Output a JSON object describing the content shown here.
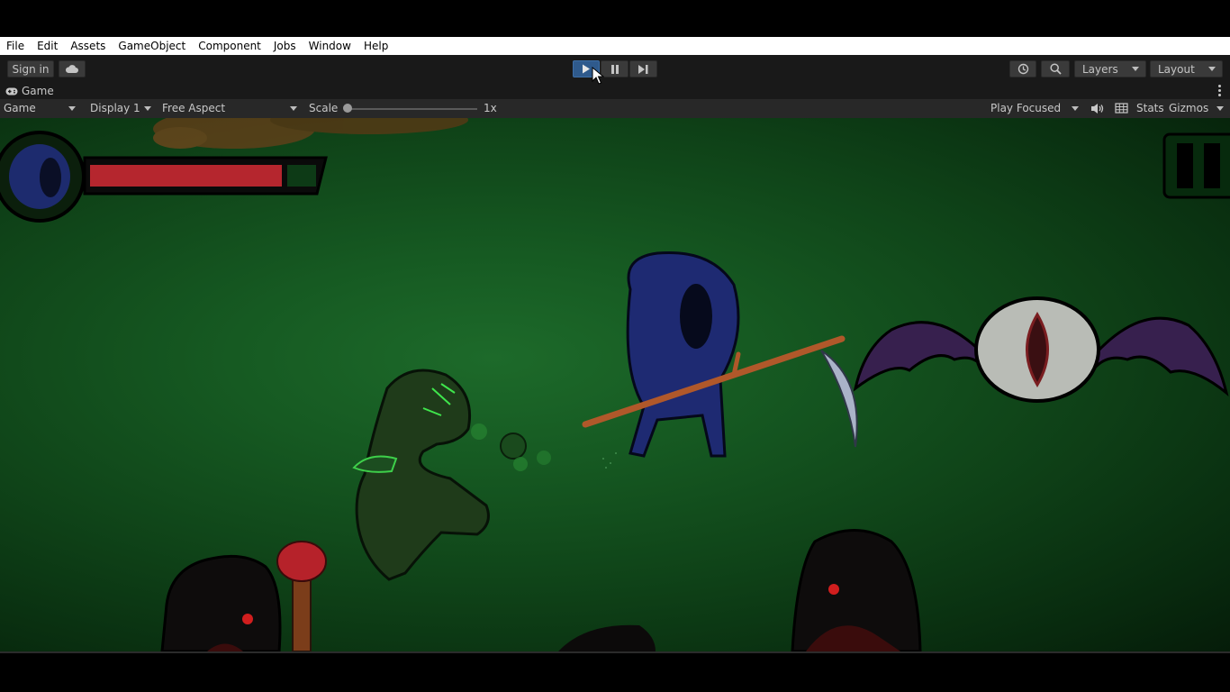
{
  "menubar": {
    "items": [
      "File",
      "Edit",
      "Assets",
      "GameObject",
      "Component",
      "Jobs",
      "Window",
      "Help"
    ]
  },
  "toolbar": {
    "sign_in_label": "Sign in",
    "cloud_icon": "cloud-icon",
    "play_icon": "play-icon",
    "pause_icon": "pause-icon",
    "step_icon": "step-icon",
    "history_icon": "history-icon",
    "search_icon": "search-icon",
    "layers_label": "Layers",
    "layout_label": "Layout",
    "play_active_color": "#2f5a8c"
  },
  "tab": {
    "icon": "gamepad-icon",
    "label": "Game"
  },
  "gamebar": {
    "view_select": "Game",
    "display_select": "Display 1",
    "aspect_select": "Free Aspect",
    "scale_label": "Scale",
    "scale_value": "1x",
    "scale_level": 0.0,
    "play_mode_select": "Play Focused",
    "mute_icon": "speaker-icon",
    "stats_grid_icon": "grid-icon",
    "stats_label": "Stats",
    "gizmos_label": "Gizmos"
  },
  "game": {
    "health_fraction": 0.85,
    "health_color": "#b5262e",
    "background_color": "#165a22",
    "pause_icon": "pause-icon"
  }
}
